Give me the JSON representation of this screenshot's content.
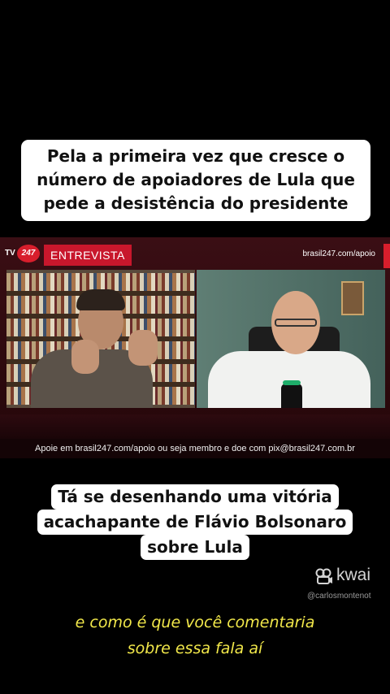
{
  "top_caption": {
    "lines": [
      "Pela a primeira vez que cresce o",
      "número de apoiadores de Lula que",
      "pede a desistência do presidente"
    ]
  },
  "video": {
    "logo_prefix": "TV",
    "logo_number": "247",
    "program_label": "ENTREVISTA",
    "site_url": "brasil247.com/apoio",
    "lower_third": "Apoie em brasil247.com/apoio ou seja membro e doe com pix@brasil247.com.br",
    "colors": {
      "brand_red": "#c8172c"
    }
  },
  "mid_caption": {
    "lines": [
      "Tá se desenhando uma vitória",
      "acachapante de Flávio Bolsonaro",
      "sobre Lula"
    ]
  },
  "watermark": {
    "brand": "kwai",
    "handle": "@carlosmontenot"
  },
  "subtitle": {
    "lines": [
      "e como é que você comentaria",
      "sobre essa fala aí"
    ],
    "color": "#f2e84a"
  }
}
